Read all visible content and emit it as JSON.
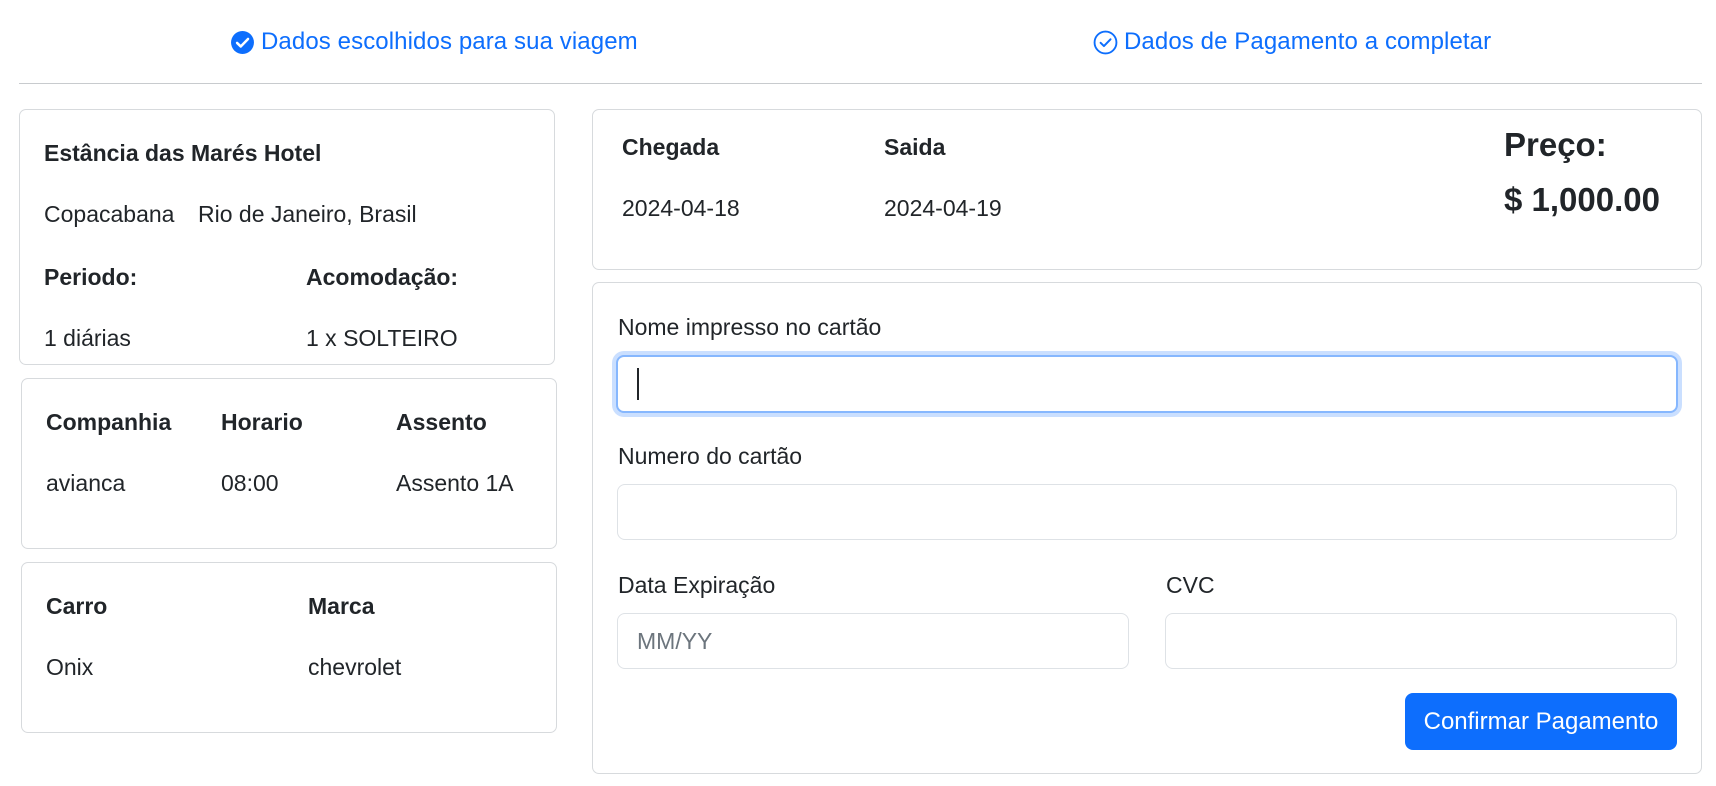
{
  "steps": {
    "chosen_label": "Dados escolhidos para sua viagem",
    "payment_label": "Dados de Pagamento a completar",
    "chosen_icon": "check-circle-fill-icon",
    "payment_icon": "check-circle-outline-icon"
  },
  "hotel": {
    "name": "Estância das Marés Hotel",
    "neighborhood": "Copacabana",
    "city": "Rio de Janeiro, Brasil",
    "period_label": "Periodo:",
    "period_value": "1 diárias",
    "accommodation_label": "Acomodação:",
    "accommodation_value": "1 x SOLTEIRO"
  },
  "flight": {
    "company_label": "Companhia",
    "company_value": "avianca",
    "time_label": "Horario",
    "time_value": "08:00",
    "seat_label": "Assento",
    "seat_value": "Assento 1A"
  },
  "car": {
    "car_label": "Carro",
    "car_value": "Onix",
    "brand_label": "Marca",
    "brand_value": "chevrolet"
  },
  "summary": {
    "arrival_label": "Chegada",
    "arrival_value": "2024-04-18",
    "departure_label": "Saida",
    "departure_value": "2024-04-19",
    "price_label": "Preço:",
    "price_value": "$ 1,000.00"
  },
  "payment_form": {
    "name_label": "Nome impresso no cartão",
    "name_value": "",
    "number_label": "Numero do cartão",
    "number_value": "",
    "expiry_label": "Data Expiração",
    "expiry_placeholder": "MM/YY",
    "cvc_label": "CVC",
    "cvc_value": "",
    "submit_label": "Confirmar Pagamento"
  },
  "colors": {
    "primary": "#0d6efd",
    "focus_ring": "#86b7fe",
    "border": "#dee2e6",
    "text": "#212529"
  }
}
